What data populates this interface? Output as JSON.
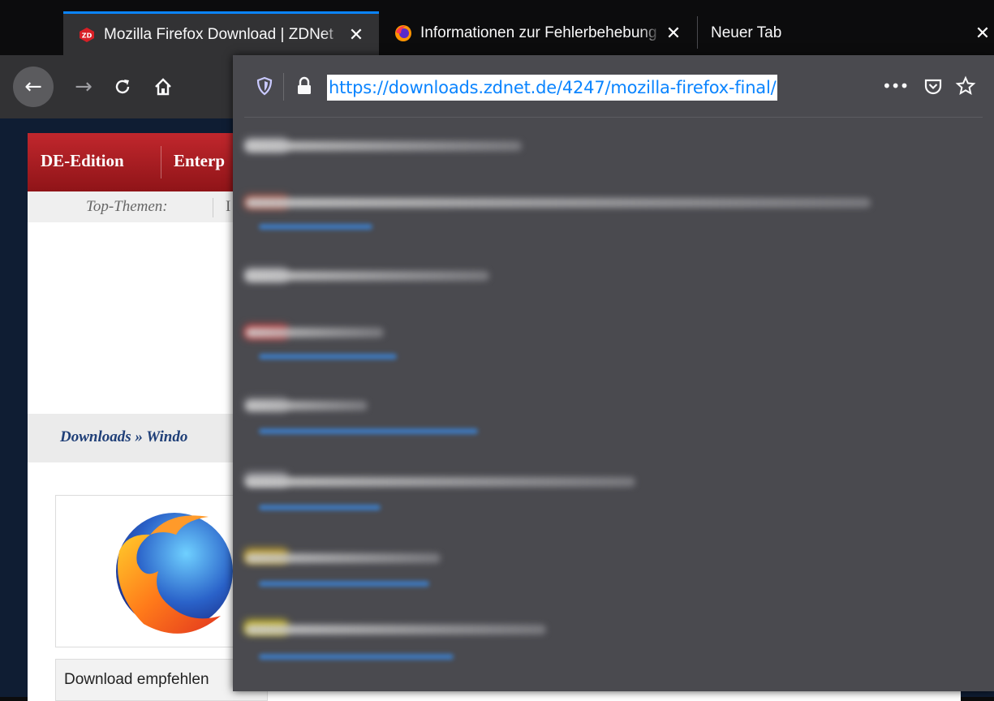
{
  "tabs": [
    {
      "title": "Mozilla Firefox Download | ZDNet",
      "icon": "zdnet-favicon-icon",
      "active": true
    },
    {
      "title": "Informationen zur Fehlerbehebung",
      "icon": "firefox-favicon-icon",
      "active": false
    },
    {
      "title": "Neuer Tab",
      "active": false
    }
  ],
  "tab_close_glyph": "✕",
  "toolbar": {
    "back_icon": "←",
    "forward_icon": "→",
    "reload_icon": "C",
    "home_icon": "⌂",
    "page_actions_icon": "•••"
  },
  "urlbar": {
    "value": "https://downloads.zdnet.de/4247/mozilla-firefox-final/"
  },
  "website": {
    "nav_items": [
      "DE-Edition",
      "Enterp"
    ],
    "topics_label": "Top-Themen:",
    "topics_first_letter": "I",
    "breadcrumb": "Downloads » Windo",
    "recommend_text": "Download empfehlen"
  },
  "colors": {
    "accent": "#0a84ff",
    "popup_bg": "#4a4a4f",
    "toolbar_bg": "#323234",
    "tabstrip_bg": "#0c0c0d",
    "site_nav_red": "#b31f24"
  }
}
